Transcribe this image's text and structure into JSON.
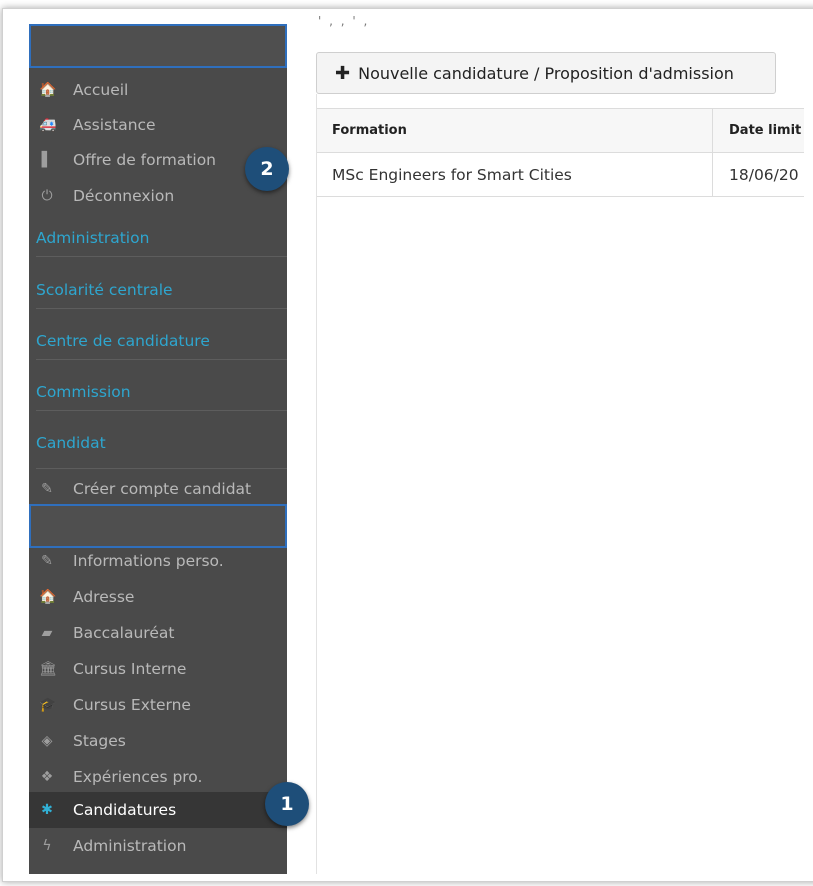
{
  "top_cut_text": "' , , ' ,",
  "sidebar": {
    "items_top": [
      {
        "label": "Accueil",
        "icon": "home-icon",
        "glyph": "🏠"
      },
      {
        "label": "Assistance",
        "icon": "support-icon",
        "glyph": "🚑"
      },
      {
        "label": "Offre de formation",
        "icon": "bookmark-icon",
        "glyph": "▌"
      },
      {
        "label": "Déconnexion",
        "icon": "power-icon",
        "glyph": "⏻"
      }
    ],
    "sections": [
      "Administration",
      "Scolarité centrale",
      "Centre de candidature",
      "Commission",
      "Candidat"
    ],
    "create_account": {
      "label": "Créer compte candidat",
      "icon": "pencil-icon",
      "glyph": "✎"
    },
    "items_candidate": [
      {
        "label": "Informations perso.",
        "icon": "pencil-icon",
        "glyph": "✎"
      },
      {
        "label": "Adresse",
        "icon": "home-icon",
        "glyph": "🏠"
      },
      {
        "label": "Baccalauréat",
        "icon": "book-icon",
        "glyph": "▰"
      },
      {
        "label": "Cursus Interne",
        "icon": "institution-icon",
        "glyph": "🏛"
      },
      {
        "label": "Cursus Externe",
        "icon": "graduation-cap-icon",
        "glyph": "🎓"
      },
      {
        "label": "Stages",
        "icon": "cube-icon",
        "glyph": "◈"
      },
      {
        "label": "Expériences pro.",
        "icon": "cubes-icon",
        "glyph": "❖"
      },
      {
        "label": "Candidatures",
        "icon": "asterisk-icon",
        "glyph": "✱"
      },
      {
        "label": "Administration",
        "icon": "bolt-icon",
        "glyph": "ϟ"
      }
    ],
    "active_item": "Candidatures",
    "accent_color": "#31b0d5"
  },
  "badges": {
    "one": "1",
    "two": "2"
  },
  "toolbar": {
    "new_label": "Nouvelle candidature / Proposition d'admission",
    "new_icon": "plus-icon"
  },
  "table": {
    "headers": [
      "Formation",
      "Date limit"
    ],
    "rows": [
      [
        "MSc Engineers for Smart Cities",
        "18/06/20"
      ]
    ]
  }
}
